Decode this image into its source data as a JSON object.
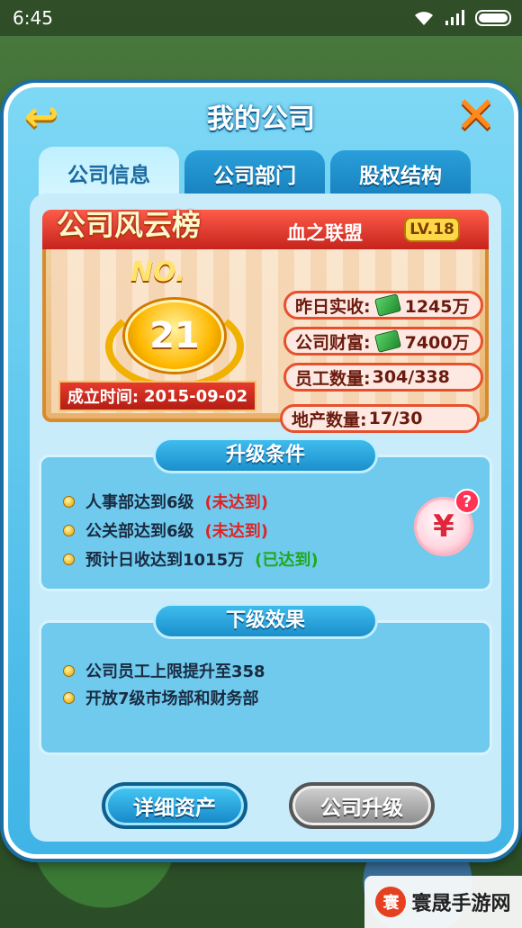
{
  "status_bar": {
    "time": "6:45"
  },
  "header": {
    "title": "我的公司"
  },
  "tabs": [
    {
      "label": "公司信息",
      "active": true
    },
    {
      "label": "公司部门",
      "active": false
    },
    {
      "label": "股权结构",
      "active": false
    }
  ],
  "rank_card": {
    "title": "公司风云榜",
    "no_label": "NO.",
    "rank": "21",
    "alliance": "血之联盟",
    "level": "LV.18",
    "founded_label": "成立时间:",
    "founded_date": "2015-09-02",
    "stats": [
      {
        "label": "昨日实收:",
        "value": "1245万",
        "icon": "money-icon"
      },
      {
        "label": "公司财富:",
        "value": "7400万",
        "icon": "money-icon"
      },
      {
        "label": "员工数量:",
        "value": "304/338"
      },
      {
        "label": "地产数量:",
        "value": "17/30"
      }
    ]
  },
  "upgrade_conditions": {
    "heading": "升级条件",
    "items": [
      {
        "text": "人事部达到6级",
        "status": "(未达到)"
      },
      {
        "text": "公关部达到6级",
        "status": "(未达到)"
      },
      {
        "text": "预计日收达到1015万",
        "status": "(已达到)"
      }
    ],
    "icon": "upgrade-yen-icon",
    "help": "?"
  },
  "next_effects": {
    "heading": "下级效果",
    "items": [
      {
        "text": "公司员工上限提升至358"
      },
      {
        "text": "开放7级市场部和财务部"
      }
    ]
  },
  "buttons": {
    "detail": "详细资产",
    "upgrade": "公司升级"
  },
  "watermark": {
    "text": "寰晟手游网",
    "logo": "寰"
  },
  "colors": {
    "panel": "#3fb4e6",
    "unmet": "#e02222",
    "met": "#21a81c"
  }
}
